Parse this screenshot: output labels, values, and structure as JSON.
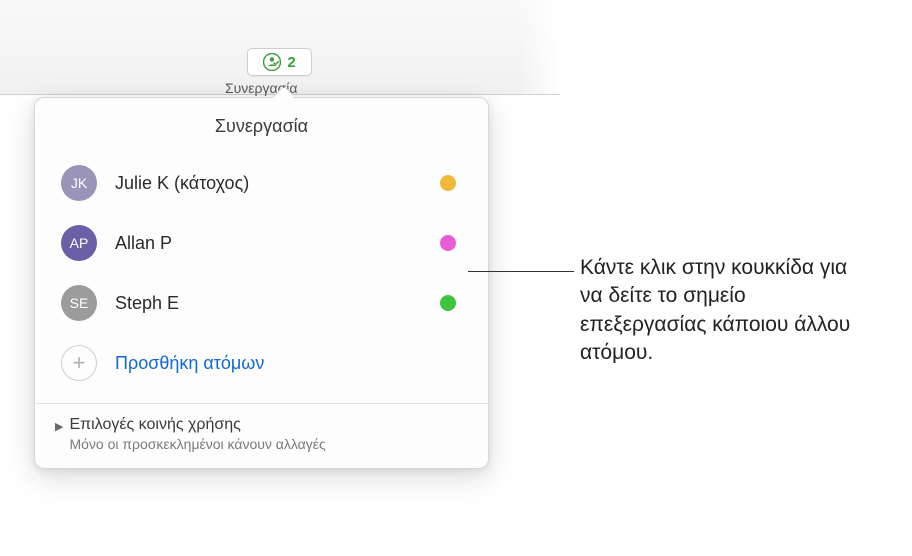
{
  "toolbar": {
    "collab_count": "2",
    "collab_label": "Συνεργασία"
  },
  "popover": {
    "title": "Συνεργασία",
    "participants": [
      {
        "initials": "JK",
        "name": "Julie K (κάτοχος)",
        "avatar_color": "#9a94b8",
        "status_color": "#f0b93a"
      },
      {
        "initials": "AP",
        "name": "Allan P",
        "avatar_color": "#6b5fa8",
        "status_color": "#e85dd6"
      },
      {
        "initials": "SE",
        "name": "Steph E",
        "avatar_color": "#9b9b9b",
        "status_color": "#3fc43f"
      }
    ],
    "add_label": "Προσθήκη ατόμων",
    "share_options_title": "Επιλογές κοινής χρήσης",
    "share_options_subtitle": "Μόνο οι προσκεκλημένοι κάνουν αλλαγές"
  },
  "callout": {
    "text": "Κάντε κλικ στην κουκκίδα για να δείτε το σημείο επεξεργασίας κάποιου άλλου ατόμου."
  }
}
